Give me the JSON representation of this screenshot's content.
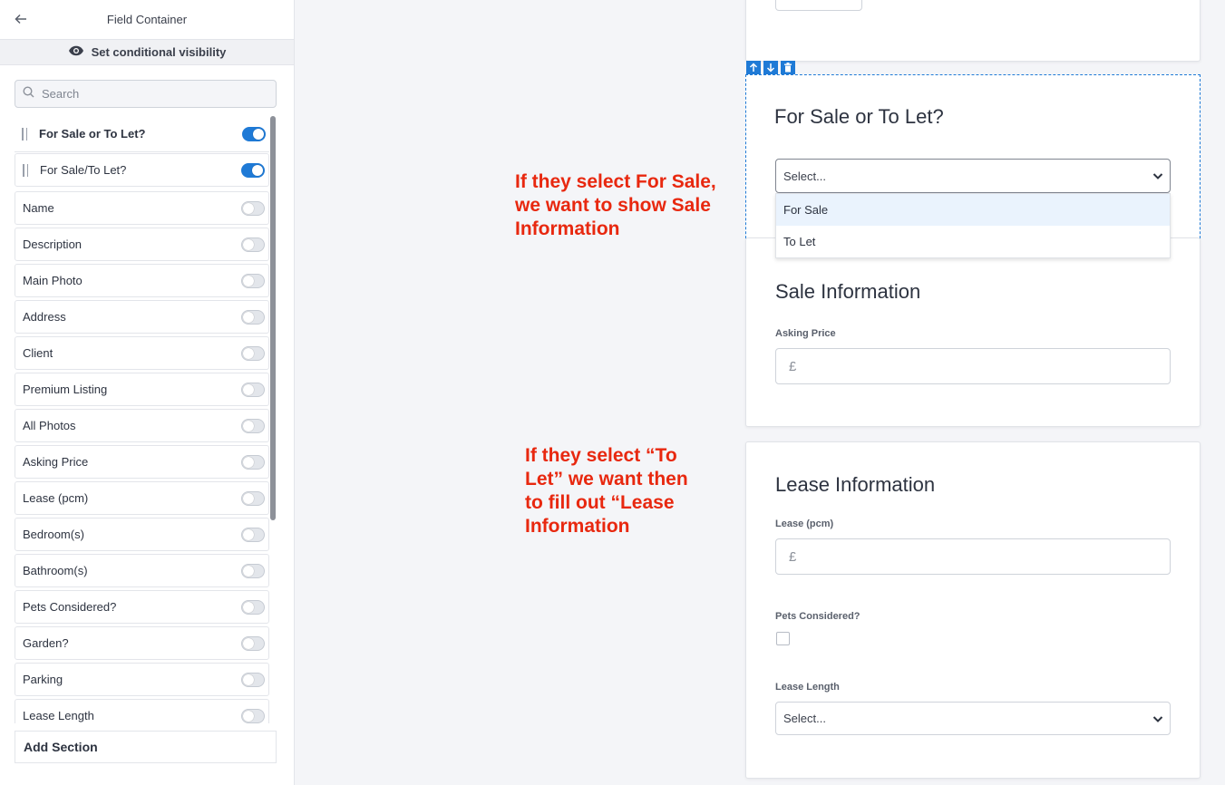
{
  "sidebar": {
    "title": "Field Container",
    "conditional_label": "Set conditional visibility",
    "search_placeholder": "Search",
    "top_items": [
      {
        "label": "For Sale or To Let?",
        "on": true
      },
      {
        "label": "For Sale/To Let?",
        "on": true
      }
    ],
    "items": [
      {
        "label": "Name",
        "on": false
      },
      {
        "label": "Description",
        "on": false
      },
      {
        "label": "Main Photo",
        "on": false
      },
      {
        "label": "Address",
        "on": false
      },
      {
        "label": "Client",
        "on": false
      },
      {
        "label": "Premium Listing",
        "on": false
      },
      {
        "label": "All Photos",
        "on": false
      },
      {
        "label": "Asking Price",
        "on": false
      },
      {
        "label": "Lease (pcm)",
        "on": false
      },
      {
        "label": "Bedroom(s)",
        "on": false
      },
      {
        "label": "Bathroom(s)",
        "on": false
      },
      {
        "label": "Pets Considered?",
        "on": false
      },
      {
        "label": "Garden?",
        "on": false
      },
      {
        "label": "Parking",
        "on": false
      },
      {
        "label": "Lease Length",
        "on": false
      }
    ],
    "add_section": "Add Section"
  },
  "canvas": {
    "for_sale_section": {
      "title": "For Sale or To Let?",
      "select_placeholder": "Select...",
      "options": [
        "For Sale",
        "To Let"
      ]
    },
    "sale_section": {
      "title": "Sale Information",
      "asking_price_label": "Asking Price",
      "currency": "£"
    },
    "lease_section": {
      "title": "Lease Information",
      "lease_label": "Lease (pcm)",
      "currency": "£",
      "pets_label": "Pets Considered?",
      "lease_length_label": "Lease Length",
      "lease_length_placeholder": "Select..."
    }
  },
  "annotations": {
    "sale_note": [
      "If they select For Sale,",
      "we want to show Sale",
      "Information"
    ],
    "lease_note": [
      "If they select “To",
      "Let” we want then",
      "to fill out “Lease",
      "Information"
    ]
  },
  "colors": {
    "accent": "#1f7ad6",
    "annotation": "#e8280f"
  }
}
